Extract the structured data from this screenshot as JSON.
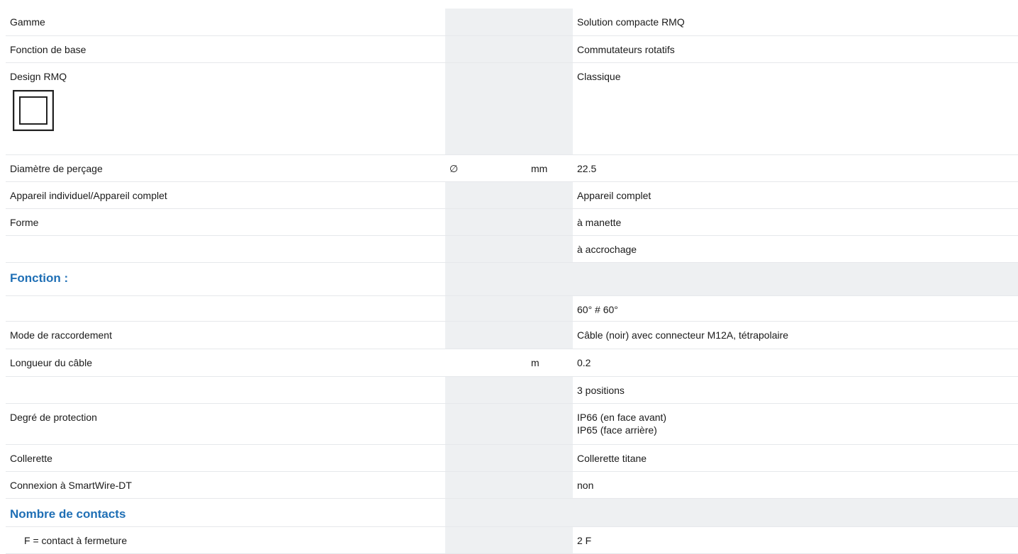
{
  "rows": [
    {
      "label": "Gamme",
      "symbol": "",
      "unit": "",
      "value": "Solution compacte RMQ"
    },
    {
      "label": "Fonction de base",
      "symbol": "",
      "unit": "",
      "value": "Commutateurs rotatifs"
    },
    {
      "label": "Design RMQ",
      "symbol": "",
      "unit": "",
      "value": "Classique",
      "icon": "rmq-classic-square-icon"
    },
    {
      "label": "Diamètre de perçage",
      "symbol": "∅",
      "unit": "mm",
      "value": "22.5"
    },
    {
      "label": "Appareil individuel/Appareil complet",
      "symbol": "",
      "unit": "",
      "value": "Appareil complet"
    },
    {
      "label": "Forme",
      "symbol": "",
      "unit": "",
      "value": "à manette"
    },
    {
      "label": "",
      "symbol": "",
      "unit": "",
      "value": "à accrochage"
    },
    {
      "label": "Fonction :",
      "section": true
    },
    {
      "label": "",
      "symbol": "",
      "unit": "",
      "value": "60° # 60°"
    },
    {
      "label": "Mode de raccordement",
      "symbol": "",
      "unit": "",
      "value": "Câble (noir) avec connecteur M12A, tétrapolaire"
    },
    {
      "label": "Longueur du câble",
      "symbol": "",
      "unit": "m",
      "value": "0.2"
    },
    {
      "label": "",
      "symbol": "",
      "unit": "",
      "value": "3 positions"
    },
    {
      "label": "Degré de protection",
      "symbol": "",
      "unit": "",
      "value_lines": [
        "IP66 (en face avant)",
        "IP65 (face arrière)"
      ]
    },
    {
      "label": "Collerette",
      "symbol": "",
      "unit": "",
      "value": "Collerette titane"
    },
    {
      "label": "Connexion à SmartWire-DT",
      "symbol": "",
      "unit": "",
      "value": "non"
    },
    {
      "label": "Nombre de contacts",
      "section": true
    },
    {
      "label": "F = contact à fermeture",
      "symbol": "",
      "unit": "",
      "value": "2 F",
      "indent": true
    }
  ],
  "colors": {
    "section_heading": "#1f6fb5",
    "shaded_column": "#eef0f2",
    "row_divider": "#e6e8eb"
  }
}
